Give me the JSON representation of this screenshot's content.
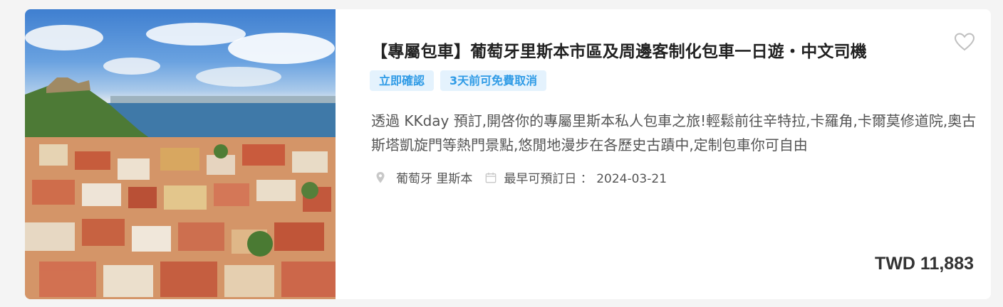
{
  "product": {
    "title": "【專屬包車】葡萄牙里斯本市區及周邊客制化包車一日遊・中文司機",
    "tags": [
      "立即確認",
      "3天前可免費取消"
    ],
    "description": "透過 KKday 預訂,開啓你的專屬里斯本私人包車之旅!輕鬆前往辛特拉,卡羅角,卡爾莫修道院,奧古斯塔凱旋門等熱門景點,悠閒地漫步在各歷史古蹟中,定制包車你可自由",
    "location": "葡萄牙 里斯本",
    "earliest_date": "最早可預訂日 ： 2024-03-21",
    "price": "TWD 11,883"
  },
  "icons": {
    "favorite": "heart-outline-icon",
    "location": "map-pin-icon",
    "calendar": "calendar-icon"
  },
  "colors": {
    "tag_background": "#e4f2fd",
    "tag_text": "#2f9be6",
    "title": "#222222",
    "price": "#333333"
  }
}
